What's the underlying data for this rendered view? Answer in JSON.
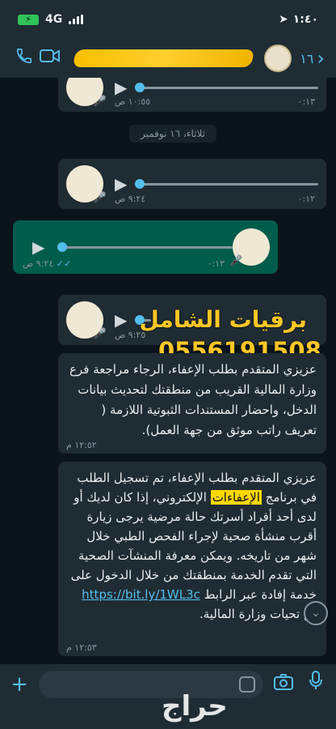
{
  "status_bar": {
    "time": "١:٤٠",
    "network": "4G",
    "battery_icon": "charging-battery-icon"
  },
  "header": {
    "back_count": "١٦",
    "icons": [
      "phone-icon",
      "video-call-icon",
      "back-chevron-icon"
    ]
  },
  "messages": {
    "voice1": {
      "duration": "٠:١٣",
      "time": "١٠:٥٥ ص"
    },
    "date_chip": "ثلاثاء، ١٦ نوفمبر",
    "voice2": {
      "duration": "٠:١٢",
      "time": "٩:٢٤ ص"
    },
    "voice3": {
      "duration": "٠:١٣",
      "time": "٩:٢٤ ص"
    },
    "voice4": {
      "time": "٩:٢٥ ص"
    },
    "text1": {
      "body": "عزيزي المتقدم بطلب الإعفاء، الرجاء مراجعة فرع وزارة المالية القريب من منطقتك لتحديث بيانات الدخل، واحضار المستندات الثبوتية اللازمة ( تعريف راتب موثق من جهة العمل).",
      "time": "١٢:٥٢ م"
    },
    "text2": {
      "part1": "عزيزي المتقدم بطلب الإعفاء، تم تسجيل الطلب في برنامج ",
      "highlight": "الإعفاءات",
      "part2": " الإلكتروني، إذا كان لديك أو لدى أحد أفراد أسرتك حالة مرضية يرجى زيارة أقرب منشأة صحية لإجراء الفحص الطبي خلال شهر من تاريخه. ويمكن معرفة المنشآت الصحية التي تقدم الخدمة بمنطقتك من خلال الدخول على خدمة إفادة عبر الرابط ",
      "link": "https://bit.ly/1WL3c",
      "part3": " مع تحيات وزارة المالية.",
      "time": "١٢:٥٣ م"
    }
  },
  "watermark": {
    "name": "برقيات الشامل",
    "phone": "0556191508",
    "brand": "حراج"
  },
  "colors": {
    "background": "#0b141a",
    "incoming_bubble": "#202c33",
    "outgoing_bubble": "#005c4b",
    "accent": "#53bdeb",
    "watermark": "#ffc726"
  }
}
